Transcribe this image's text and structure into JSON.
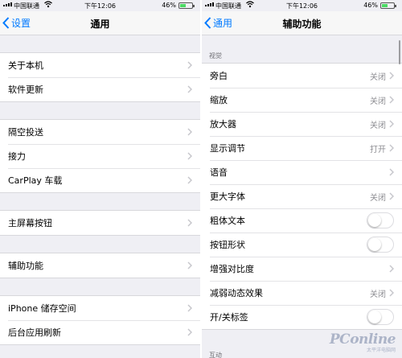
{
  "status_bar": {
    "carrier": "中国联通",
    "time": "下午12:06",
    "battery_percent": "46%",
    "battery_level": 0.46
  },
  "left_screen": {
    "nav": {
      "back_label": "设置",
      "title": "通用"
    },
    "groups": [
      [
        {
          "label": "关于本机"
        },
        {
          "label": "软件更新"
        }
      ],
      [
        {
          "label": "隔空投送"
        },
        {
          "label": "接力"
        },
        {
          "label": "CarPlay 车载"
        }
      ],
      [
        {
          "label": "主屏幕按钮"
        }
      ],
      [
        {
          "label": "辅助功能"
        }
      ],
      [
        {
          "label": "iPhone 储存空间"
        },
        {
          "label": "后台应用刷新"
        }
      ]
    ]
  },
  "right_screen": {
    "nav": {
      "back_label": "通用",
      "title": "辅助功能"
    },
    "section_vision": "视觉",
    "rows": [
      {
        "label": "旁白",
        "value": "关闭"
      },
      {
        "label": "缩放",
        "value": "关闭"
      },
      {
        "label": "放大器",
        "value": "关闭"
      },
      {
        "label": "显示调节",
        "value": "打开"
      },
      {
        "label": "语音",
        "value": ""
      },
      {
        "label": "更大字体",
        "value": "关闭"
      },
      {
        "label": "粗体文本",
        "toggle": false
      },
      {
        "label": "按钮形状",
        "toggle": false
      },
      {
        "label": "增强对比度",
        "value": ""
      },
      {
        "label": "减弱动态效果",
        "value": "关闭"
      },
      {
        "label": "开/关标签",
        "toggle": false
      }
    ],
    "section_interaction": "互动"
  },
  "watermark": {
    "text": "PConline",
    "sub": "太平洋电脑网"
  },
  "colors": {
    "accent": "#007aff",
    "background": "#efeff4",
    "secondary_text": "#8e8e93",
    "battery": "#4cd964"
  }
}
